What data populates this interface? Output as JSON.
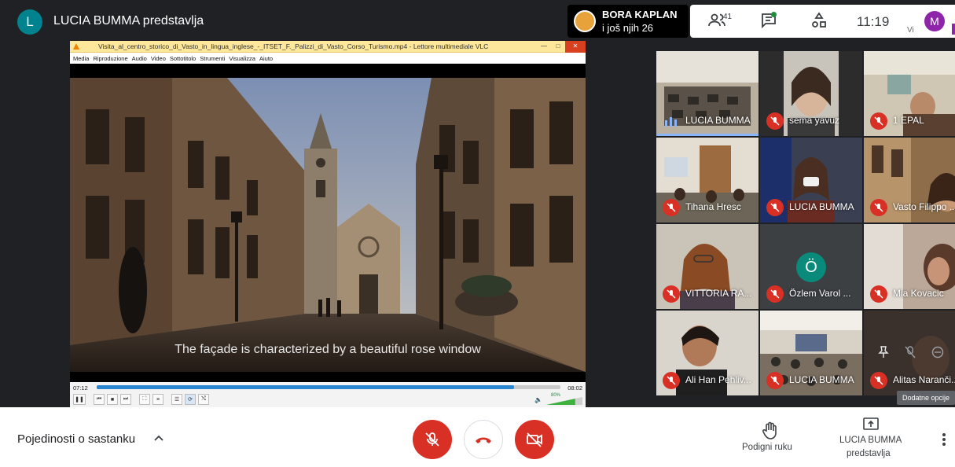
{
  "header": {
    "presenter_initial": "L",
    "presenter_title": "LUCIA BUMMA predstavlja",
    "raised_hand_name": "BORA KAPLAN",
    "raised_hand_more": "i još njih 26",
    "people_count": "41",
    "clock": "11:19",
    "you_label": "Vi",
    "me_initial": "M",
    "colors": {
      "me_avatar": "#8e24aa",
      "presenter_avatar": "#00838f",
      "chat_dot": "#1e8e3e"
    }
  },
  "vlc": {
    "window_title": "Visita_al_centro_storico_di_Vasto_in_lingua_inglese_-_ITSET_F._Palizzi_di_Vasto_Corso_Turismo.mp4 - Lettore multimediale VLC",
    "menu": [
      "Media",
      "Riproduzione",
      "Audio",
      "Video",
      "Sottotitolo",
      "Strumenti",
      "Visualizza",
      "Aiuto"
    ],
    "subtitle": "The façade is characterized by a beautiful rose window",
    "time_current": "07:12",
    "time_total": "08:02",
    "seek_fraction": 0.9,
    "volume_label": "80%",
    "volume_fraction": 0.8
  },
  "participants": [
    {
      "name": "LUCIA BUMMA",
      "muted": false,
      "speaking": true
    },
    {
      "name": "sema yavuz",
      "muted": true
    },
    {
      "name": "1 EPAL",
      "muted": true
    },
    {
      "name": "Tihana Hresc",
      "muted": true
    },
    {
      "name": "LUCIA BUMMA",
      "muted": true
    },
    {
      "name": "Vasto Filippo ...",
      "muted": true
    },
    {
      "name": "VITTORIA RA...",
      "muted": true
    },
    {
      "name": "Özlem Varol ...",
      "muted": true,
      "initial": "Ö"
    },
    {
      "name": "Mia Kovacic",
      "muted": true
    },
    {
      "name": "Ali Han Pehliv...",
      "muted": true
    },
    {
      "name": "LUCIA BUMMA",
      "muted": true
    },
    {
      "name": "Alitas Naranči...",
      "muted": true
    }
  ],
  "tooltip": "Dodatne opcije",
  "bottom": {
    "details": "Pojedinosti o sastanku",
    "raise_hand": "Podigni ruku",
    "presenting_line1": "LUCIA BUMMA",
    "presenting_line2": "predstavlja"
  }
}
